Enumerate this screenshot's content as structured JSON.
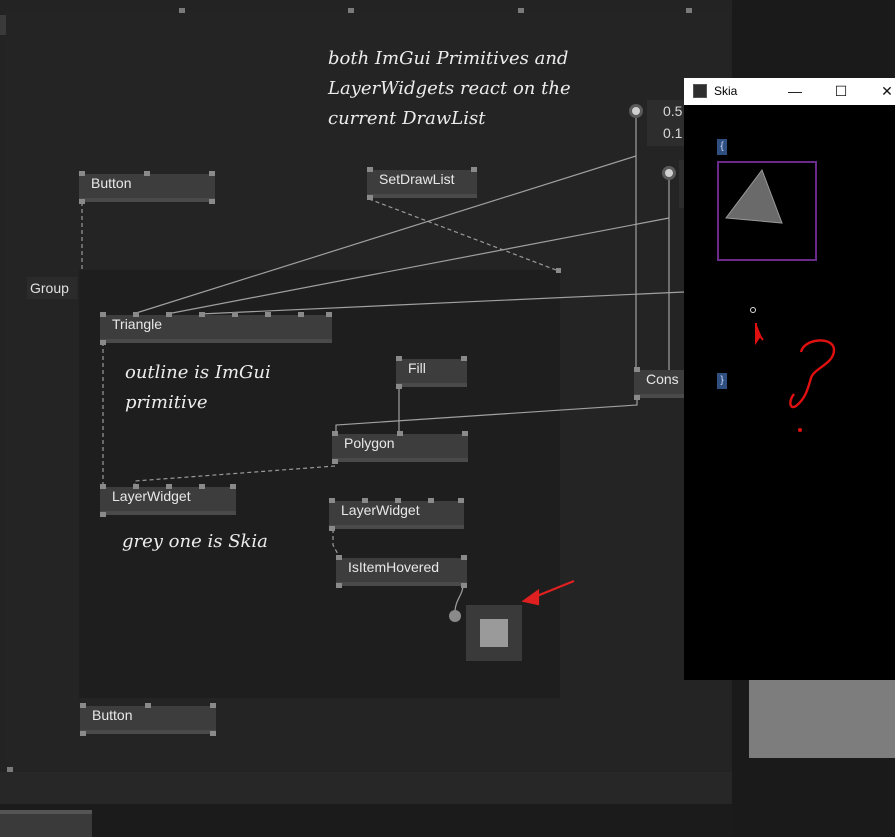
{
  "nodes": {
    "button_top": "Button",
    "setdrawlist": "SetDrawList",
    "group": "Group",
    "triangle": "Triangle",
    "fill": "Fill",
    "polygon": "Polygon",
    "layerwidget_left": "LayerWidget",
    "layerwidget_right": "LayerWidget",
    "isitemhovered": "IsItemHovered",
    "button_bottom": "Button",
    "cons": "Cons"
  },
  "iobox": {
    "line1": "0.5",
    "line2": "0.1"
  },
  "comments": {
    "top": "both ImGui Primitives and\nLayerWidgets react on the\ncurrent DrawList",
    "outline": "outline is ImGui\nprimitive",
    "grey": "grey one is Skia"
  },
  "skia_window": {
    "title": "Skia",
    "minimize": "—",
    "maximize": "☐",
    "close": "✕",
    "brace_open": "{",
    "brace_close": "}"
  },
  "annotation": {
    "question_mark": "?",
    "color": "#e01010"
  },
  "colors": {
    "wire": "#a0a0a0",
    "outline": "#6a2a8a",
    "red_arrow": "#e02020"
  }
}
